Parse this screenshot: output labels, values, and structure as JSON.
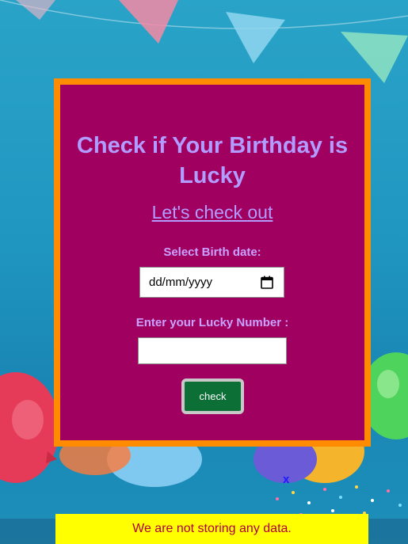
{
  "card": {
    "title": "Check if Your Birthday is Lucky",
    "subtitle_link": "Let's check out",
    "birth_date_label": "Select Birth date:",
    "birth_date_placeholder": "dd/mm/yyyy",
    "lucky_number_label": "Enter your Lucky Number :",
    "lucky_number_value": "",
    "check_button": "check"
  },
  "overlay": {
    "close_label": "x",
    "notice_text": "We are not storing any data."
  },
  "icons": {
    "calendar": "calendar-icon"
  },
  "colors": {
    "card_background": "#a0005f",
    "card_border": "#ff8c00",
    "title_color": "#b39cff",
    "button_background": "#0b6f36",
    "notice_background": "#ffff00",
    "notice_text_color": "#b0003a"
  }
}
